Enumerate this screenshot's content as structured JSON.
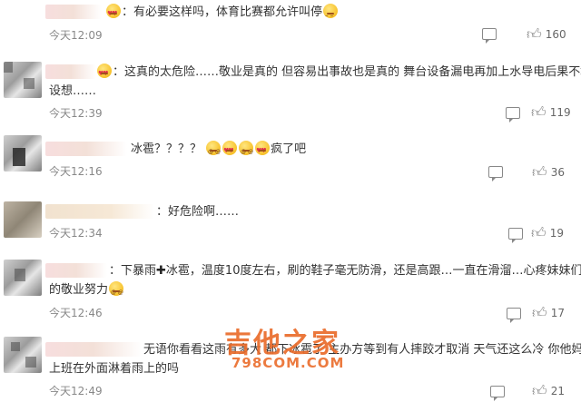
{
  "comments": [
    {
      "text": "：有必要这样吗，体育比赛都允许叫停",
      "text2": "",
      "time": "今天12:09",
      "likes": "160",
      "emojis_before": [
        "heart-eyes-emoji"
      ],
      "emojis_after": [
        "sleepy-emoji"
      ]
    },
    {
      "text": "：这真的太危险……敬业是真的 但容易出事故也是真的 舞台设备漏电再加上水导电后果不堪",
      "text2": "设想……",
      "time": "今天12:39",
      "likes": "119"
    },
    {
      "text": "冰雹？？？？",
      "text_after": "疯了吧",
      "time": "今天12:16",
      "likes": "36"
    },
    {
      "text": "：好危险啊……",
      "text2": "",
      "time": "今天12:34",
      "likes": "19"
    },
    {
      "text": "：下暴雨",
      "cross": "✚",
      "text_cont": "冰雹，温度10度左右，刷的鞋子毫无防滑，还是高跟…一直在滑溜…心疼妹妹们",
      "text2": "的敬业努力",
      "time": "今天12:46",
      "likes": "17"
    },
    {
      "text": "无语你看看这雨有多大 都下冰雹了 主办方等到有人摔跤才取消 天气还这么冷 你他妈",
      "text2": "上班在外面淋着雨上的吗",
      "time": "今天12:49",
      "likes": "21"
    }
  ],
  "watermark": {
    "main": "吉他之家",
    "sub": "798COM.COM"
  },
  "icons": {
    "reply": "comment-reply-icon",
    "like": "thumbs-up-icon"
  },
  "colors": {
    "watermark": "#ea6c2b",
    "text": "#333333",
    "meta": "#888888"
  }
}
